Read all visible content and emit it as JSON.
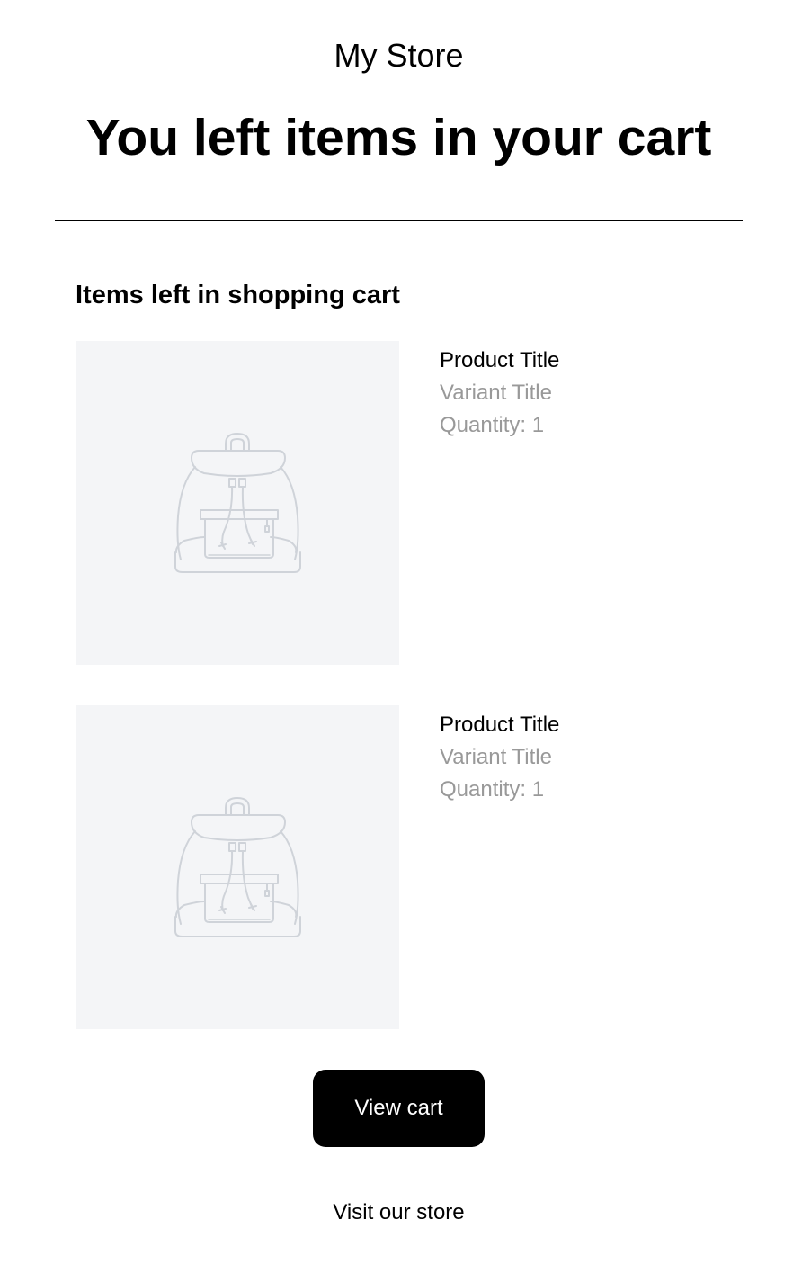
{
  "header": {
    "store_name": "My Store",
    "headline": "You left items in your cart"
  },
  "cart": {
    "section_title": "Items left in shopping cart",
    "items": [
      {
        "product_title": "Product Title",
        "variant_title": "Variant Title",
        "quantity": "Quantity: 1",
        "image_icon": "backpack-placeholder-icon"
      },
      {
        "product_title": "Product Title",
        "variant_title": "Variant Title",
        "quantity": "Quantity: 1",
        "image_icon": "backpack-placeholder-icon"
      }
    ]
  },
  "actions": {
    "view_cart_label": "View cart",
    "visit_store_label": "Visit our store"
  },
  "colors": {
    "text": "#000000",
    "muted_text": "#999999",
    "image_placeholder_bg": "#f4f5f7",
    "button_bg": "#000000",
    "button_text": "#ffffff"
  }
}
